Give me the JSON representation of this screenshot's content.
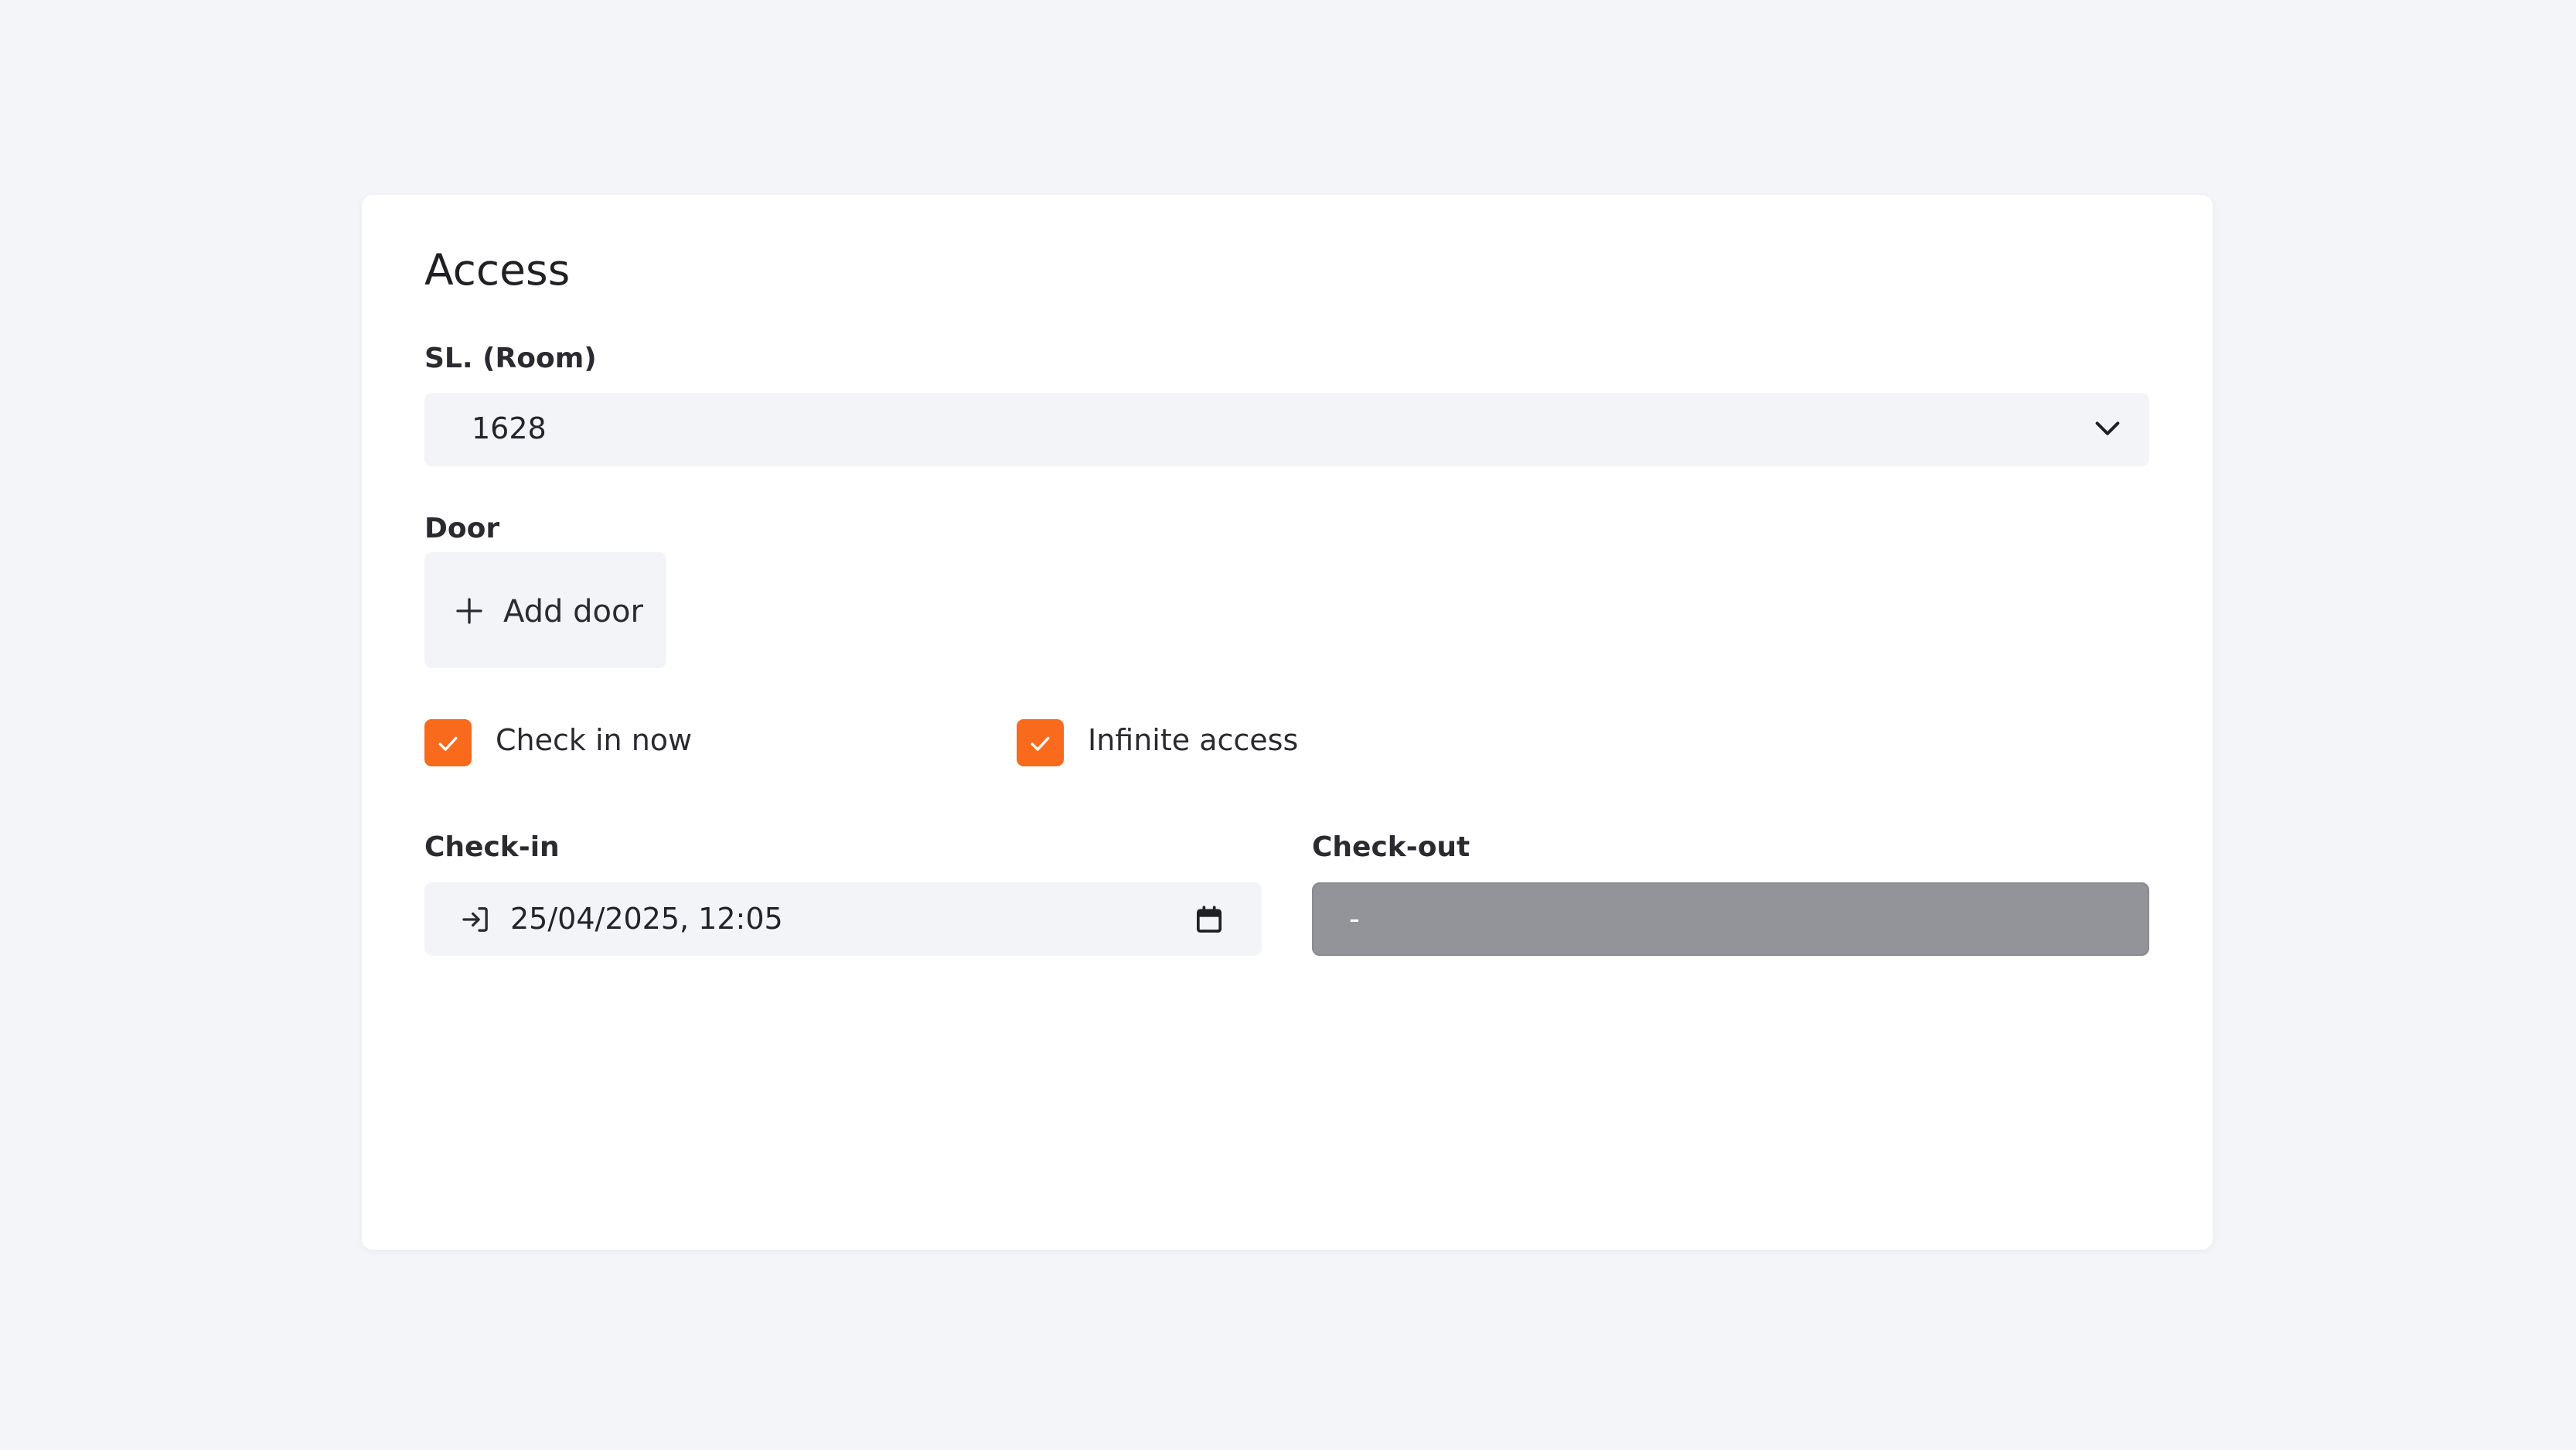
{
  "card": {
    "title": "Access"
  },
  "room": {
    "label": "SL. (Room)",
    "selected": "1628"
  },
  "door": {
    "label": "Door",
    "add_label": "Add door"
  },
  "options": {
    "check_in_now": {
      "label": "Check in now",
      "checked": true
    },
    "infinite_access": {
      "label": "Infinite access",
      "checked": true
    }
  },
  "checkin": {
    "label": "Check-in",
    "value": "25/04/2025, 12:05"
  },
  "checkout": {
    "label": "Check-out",
    "value": "-"
  },
  "colors": {
    "accent": "#f96a1c",
    "field_bg": "#f3f4f7",
    "disabled_bg": "#939499",
    "page_bg": "#f3f5f8"
  }
}
